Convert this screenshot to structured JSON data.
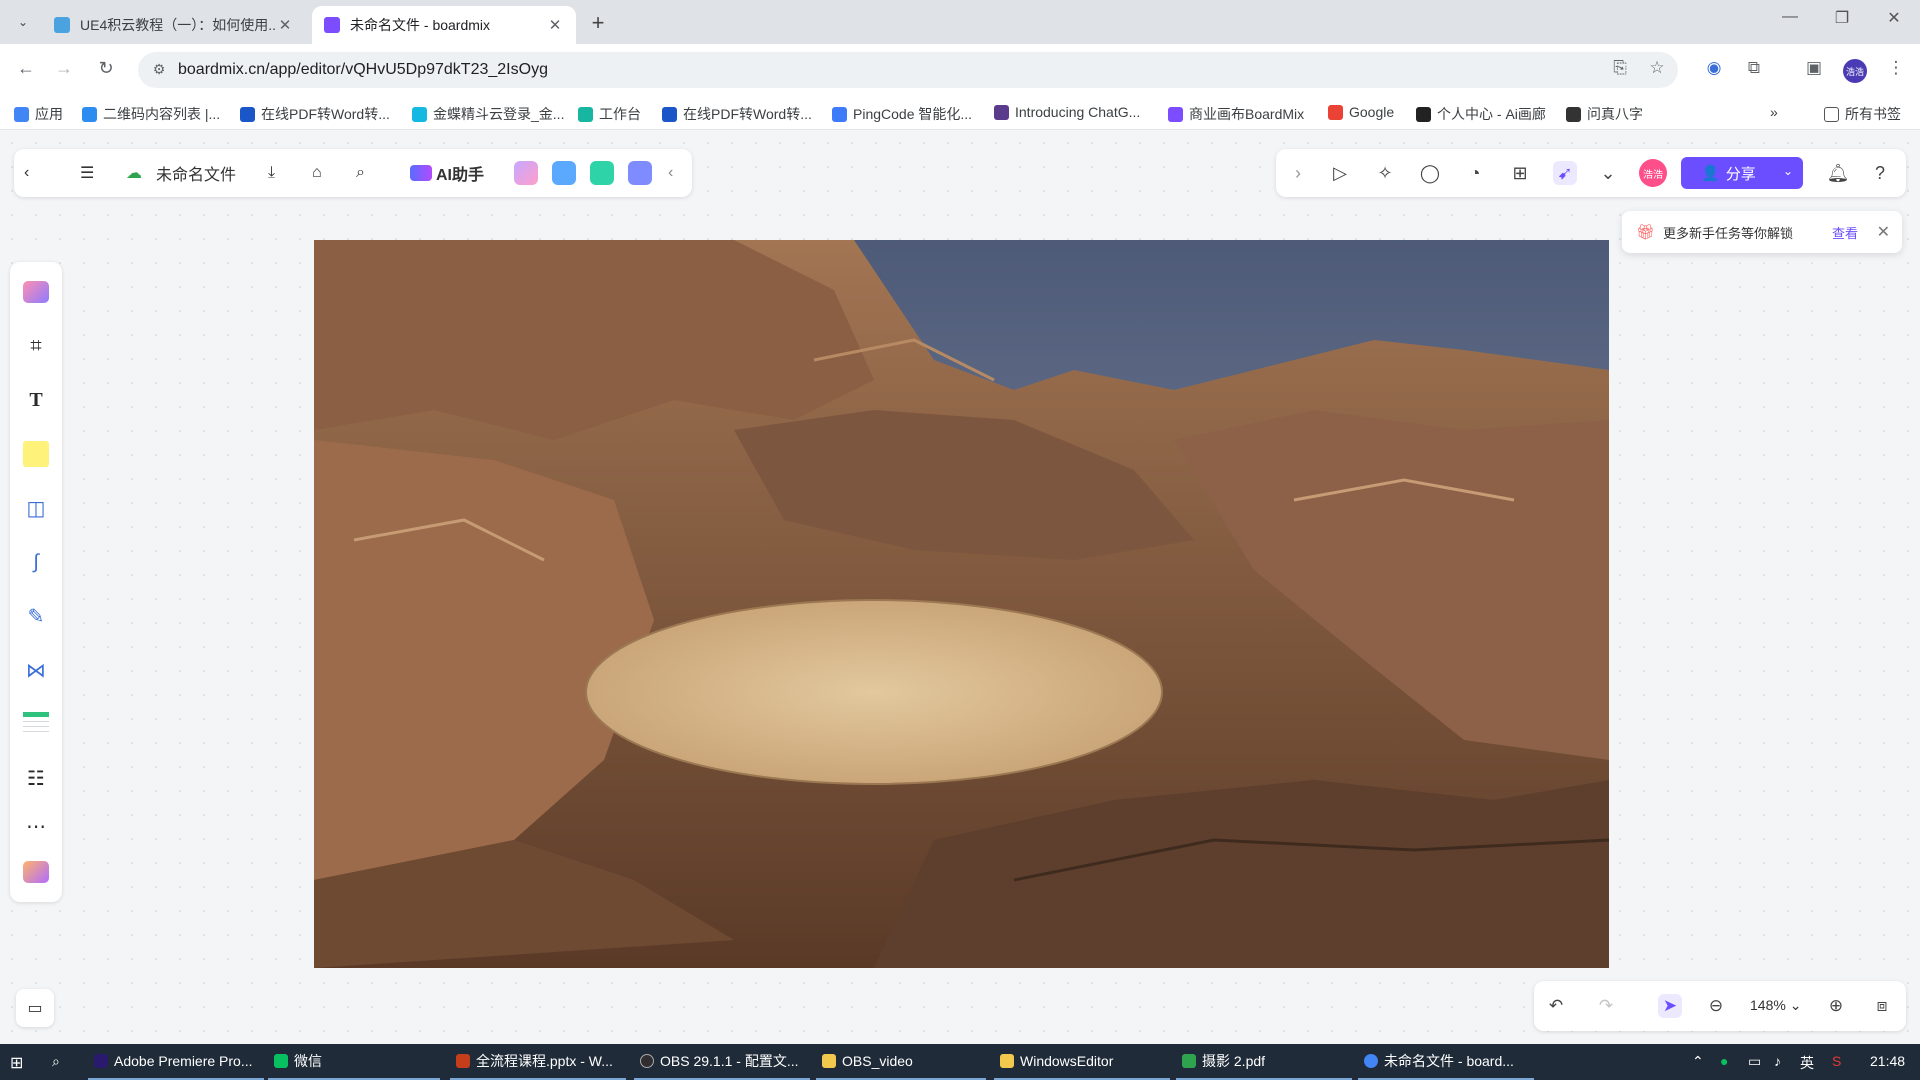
{
  "browser": {
    "tabs": [
      {
        "title": "UE4积云教程（一）：如何使用...",
        "active": false
      },
      {
        "title": "未命名文件 - boardmix",
        "active": true
      }
    ],
    "new_tab_label": "+",
    "url": "boardmix.cn/app/editor/vQHvU5Dp97dkT23_2IsOyg",
    "profile_initials": "浩浩",
    "bookmarks": [
      {
        "label": "应用",
        "color": "#4285f4"
      },
      {
        "label": "二维码内容列表 |...",
        "color": "#2d8cf0"
      },
      {
        "label": "在线PDF转Word转...",
        "color": "#1a56c8"
      },
      {
        "label": "金蝶精斗云登录_金...",
        "color": "#14b8e0"
      },
      {
        "label": "工作台",
        "color": "#16b6a0"
      },
      {
        "label": "在线PDF转Word转...",
        "color": "#1a56c8"
      },
      {
        "label": "PingCode 智能化...",
        "color": "#3e7bfa"
      },
      {
        "label": "Introducing ChatG...",
        "color": "#5b3b8c"
      },
      {
        "label": "商业画布BoardMix",
        "color": "#7c4dff"
      },
      {
        "label": "Google",
        "color": "#ea4335"
      },
      {
        "label": "个人中心 - Ai画廊",
        "color": "#222222"
      },
      {
        "label": "问真八字",
        "color": "#333333"
      }
    ],
    "bookmarks_more": "»",
    "all_bookmarks": "所有书签"
  },
  "app": {
    "file_name": "未命名文件",
    "ai_label": "AI助手",
    "user_avatar_text": "浩浩",
    "share_label": "分享",
    "toast": {
      "text": "更多新手任务等你解锁",
      "link": "查看"
    },
    "zoom": "148%",
    "accent_color": "#6b4eff"
  },
  "taskbar": {
    "items": [
      {
        "label": "Adobe Premiere Pro...",
        "color": "#2a1a6e"
      },
      {
        "label": "微信",
        "color": "#07c160"
      },
      {
        "label": "全流程课程.pptx - W...",
        "color": "#c43e1c"
      },
      {
        "label": "OBS 29.1.1 - 配置文...",
        "color": "#302e31"
      },
      {
        "label": "OBS_video",
        "color": "#f2c94c"
      },
      {
        "label": "WindowsEditor",
        "color": "#f2c94c"
      },
      {
        "label": "摄影 2.pdf",
        "color": "#2ea44f"
      },
      {
        "label": "未命名文件 - board...",
        "color": "#4285f4"
      }
    ],
    "ime": "英",
    "time": "21:48"
  }
}
